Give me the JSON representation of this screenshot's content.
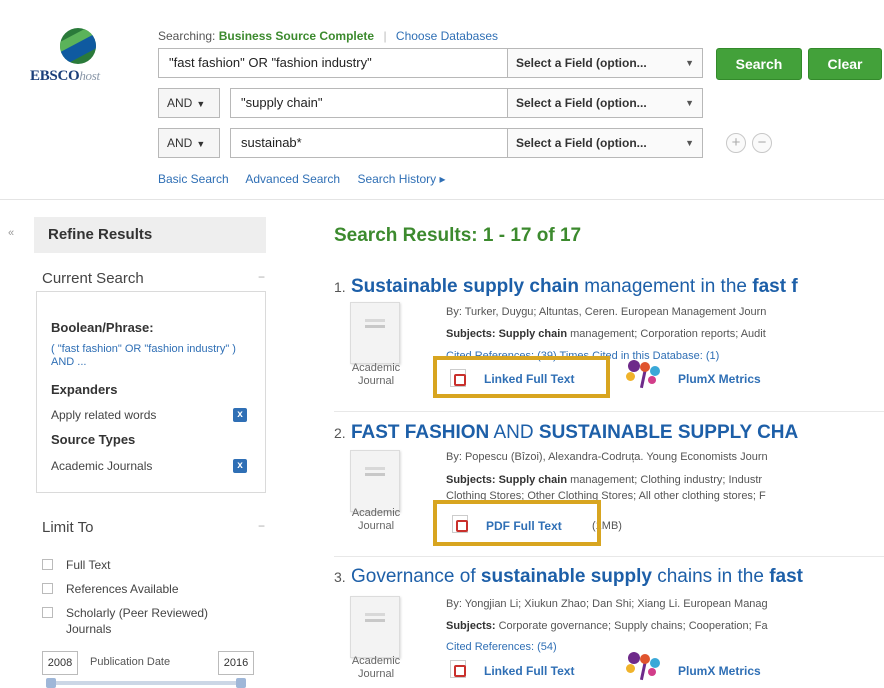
{
  "logo": {
    "brand": "EBSCO",
    "suffix": "host"
  },
  "search": {
    "searching_label": "Searching:",
    "database": "Business Source Complete",
    "choose_db": "Choose Databases",
    "rows": [
      {
        "bool": "",
        "term": "\"fast fashion\" OR \"fashion industry\"",
        "field": "Select a Field (option..."
      },
      {
        "bool": "AND",
        "term": "\"supply chain\"",
        "field": "Select a Field (option..."
      },
      {
        "bool": "AND",
        "term": "sustainab*",
        "field": "Select a Field (option..."
      }
    ],
    "search_btn": "Search",
    "clear_btn": "Clear",
    "add_row": "+",
    "remove_row": "−",
    "links": [
      "Basic Search",
      "Advanced Search",
      "Search History ▸"
    ]
  },
  "sidebar": {
    "collapse": "«",
    "refine_title": "Refine Results",
    "current_search_title": "Current Search",
    "boolean_label": "Boolean/Phrase:",
    "boolean_query": "( \"fast fashion\" OR \"fashion industry\" ) AND ...",
    "expanders_label": "Expanders",
    "expander_item": "Apply related words",
    "source_types_label": "Source Types",
    "source_type_item": "Academic Journals",
    "remove_x": "x",
    "limit_title": "Limit To",
    "limit_items": [
      "Full Text",
      "References Available",
      "Scholarly (Peer Reviewed)",
      "Journals"
    ],
    "date_from": "2008",
    "date_label": "Publication Date",
    "date_to": "2016",
    "panel_minus": "−"
  },
  "results": {
    "title": "Search Results: 1 - 17 of 17",
    "items": [
      {
        "num": "1.",
        "title_parts": [
          "Sustainable supply chain",
          " management in the ",
          "fast f"
        ],
        "by": "By: Turker, Duygu; Altuntas, Ceren. European Management Journ",
        "subjects_label": "Subjects:",
        "subjects_bold": "Supply chain",
        "subjects_rest": " management; Corporation reports; Audit",
        "cited": "Cited References: (39) Times Cited in this Database: (1)",
        "doc_type": "Academic Journal",
        "ft_label": "Linked Full Text",
        "plumx": "PlumX Metrics"
      },
      {
        "num": "2.",
        "title_parts": [
          "FAST FASHION",
          " AND ",
          "SUSTAINABLE SUPPLY CHA"
        ],
        "by": "By: Popescu (Bîzoi), Alexandra-Codruța. Young Economists Journ",
        "subjects_label": "Subjects:",
        "subjects_bold": "Supply chain",
        "subjects_rest": " management; Clothing industry; Industr",
        "subjects2": "Clothing Stores; Other Clothing Stores; All other clothing stores; F",
        "doc_type": "Academic Journal",
        "ft_label": "PDF Full Text",
        "ft_size": "(1MB)"
      },
      {
        "num": "3.",
        "title_parts": [
          "Governance of ",
          "sustainable supply",
          " chains in the ",
          "fast"
        ],
        "by": "By: Yongjian Li; Xiukun Zhao; Dan Shi; Xiang Li. European Manag",
        "subjects_label": "Subjects:",
        "subjects_rest": " Corporate governance; Supply chains; Cooperation; Fa",
        "cited": "Cited References: (54)",
        "doc_type": "Academic Journal",
        "ft_label": "Linked Full Text",
        "plumx": "PlumX Metrics"
      }
    ]
  },
  "colors": {
    "accent_green": "#43a13a",
    "link_blue": "#1d5fa8",
    "highlight": "#d8a520"
  }
}
